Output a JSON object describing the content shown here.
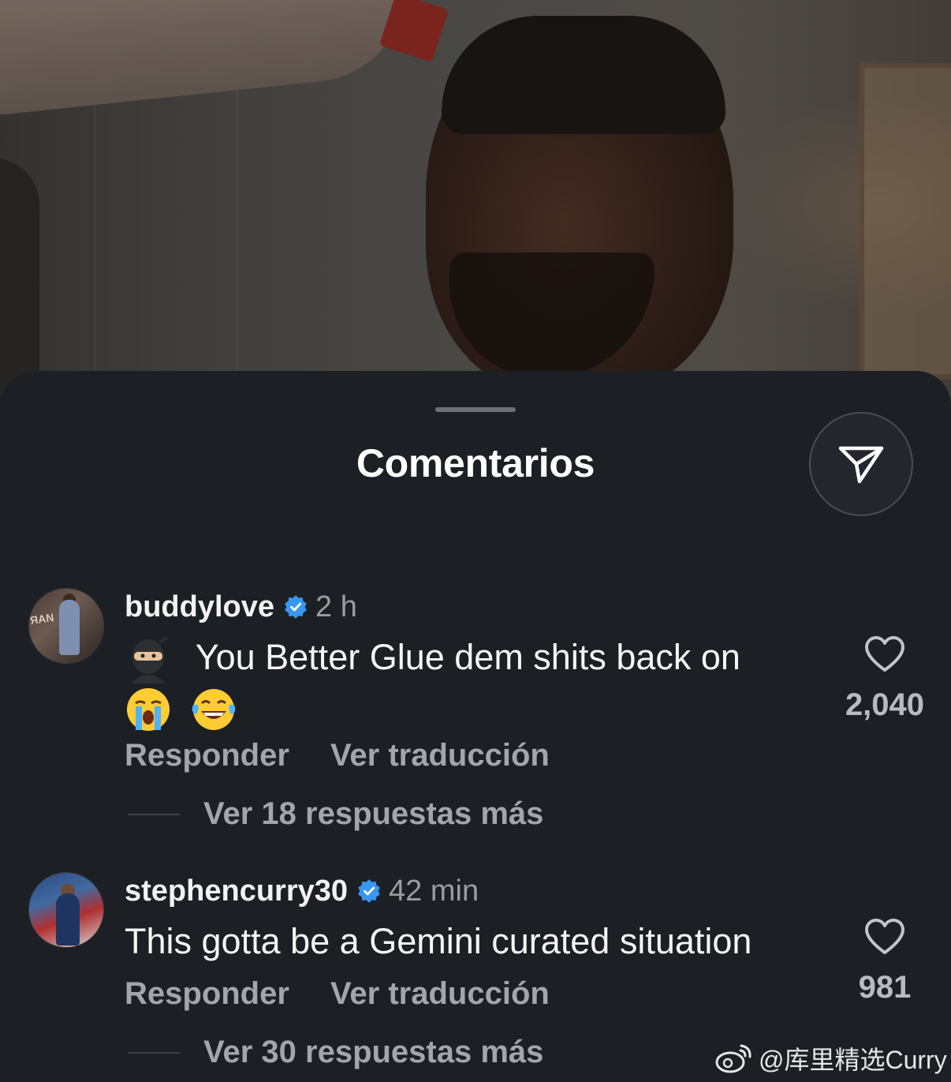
{
  "sheet": {
    "title": "Comentarios"
  },
  "icons": {
    "share": "send-icon",
    "like": "heart-icon",
    "verified": "verified-badge-icon"
  },
  "colors": {
    "background": "#1c1f24",
    "verified": "#3897f0",
    "secondary_text": "#a3a5aa"
  },
  "comments": [
    {
      "username": "buddylove",
      "time": "2 h",
      "verified": true,
      "text": "You Better Glue dem shits back on",
      "emojis": [
        "ninja",
        "loudly-crying-face",
        "face-with-tears-of-joy"
      ],
      "likes": "2,040",
      "reply_label": "Responder",
      "translate_label": "Ver traducción",
      "more_replies": "Ver 18 respuestas más"
    },
    {
      "username": "stephencurry30",
      "time": "42 min",
      "verified": true,
      "text": "This gotta be a Gemini curated situation",
      "likes": "981",
      "reply_label": "Responder",
      "translate_label": "Ver traducción",
      "more_replies": "Ver 30 respuestas más"
    }
  ],
  "watermark": {
    "text": "@库里精选Curry"
  }
}
